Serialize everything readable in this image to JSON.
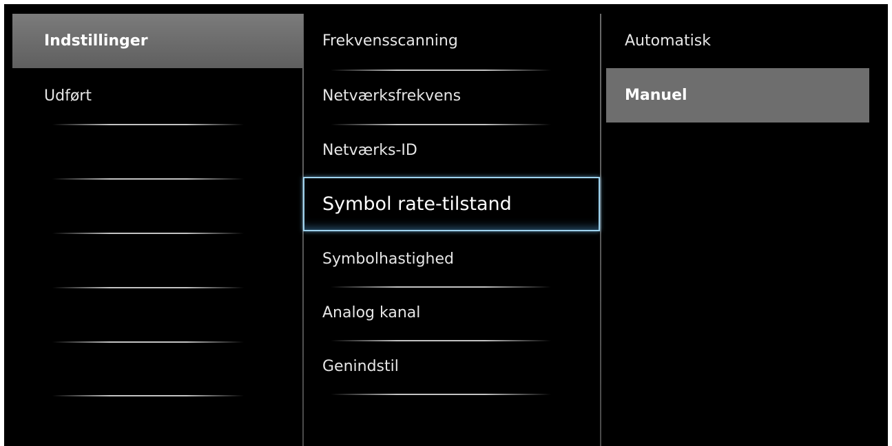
{
  "left_menu": {
    "items": [
      {
        "label": "Indstillinger"
      },
      {
        "label": "Udført"
      }
    ]
  },
  "middle_menu": {
    "items": [
      {
        "label": "Frekvensscanning"
      },
      {
        "label": "Netværksfrekvens"
      },
      {
        "label": "Netværks-ID"
      },
      {
        "label": "Symbol rate-tilstand"
      },
      {
        "label": "Symbolhastighed"
      },
      {
        "label": "Analog kanal"
      },
      {
        "label": "Genindstil"
      }
    ]
  },
  "right_menu": {
    "items": [
      {
        "label": "Automatisk"
      },
      {
        "label": "Manuel"
      }
    ]
  }
}
